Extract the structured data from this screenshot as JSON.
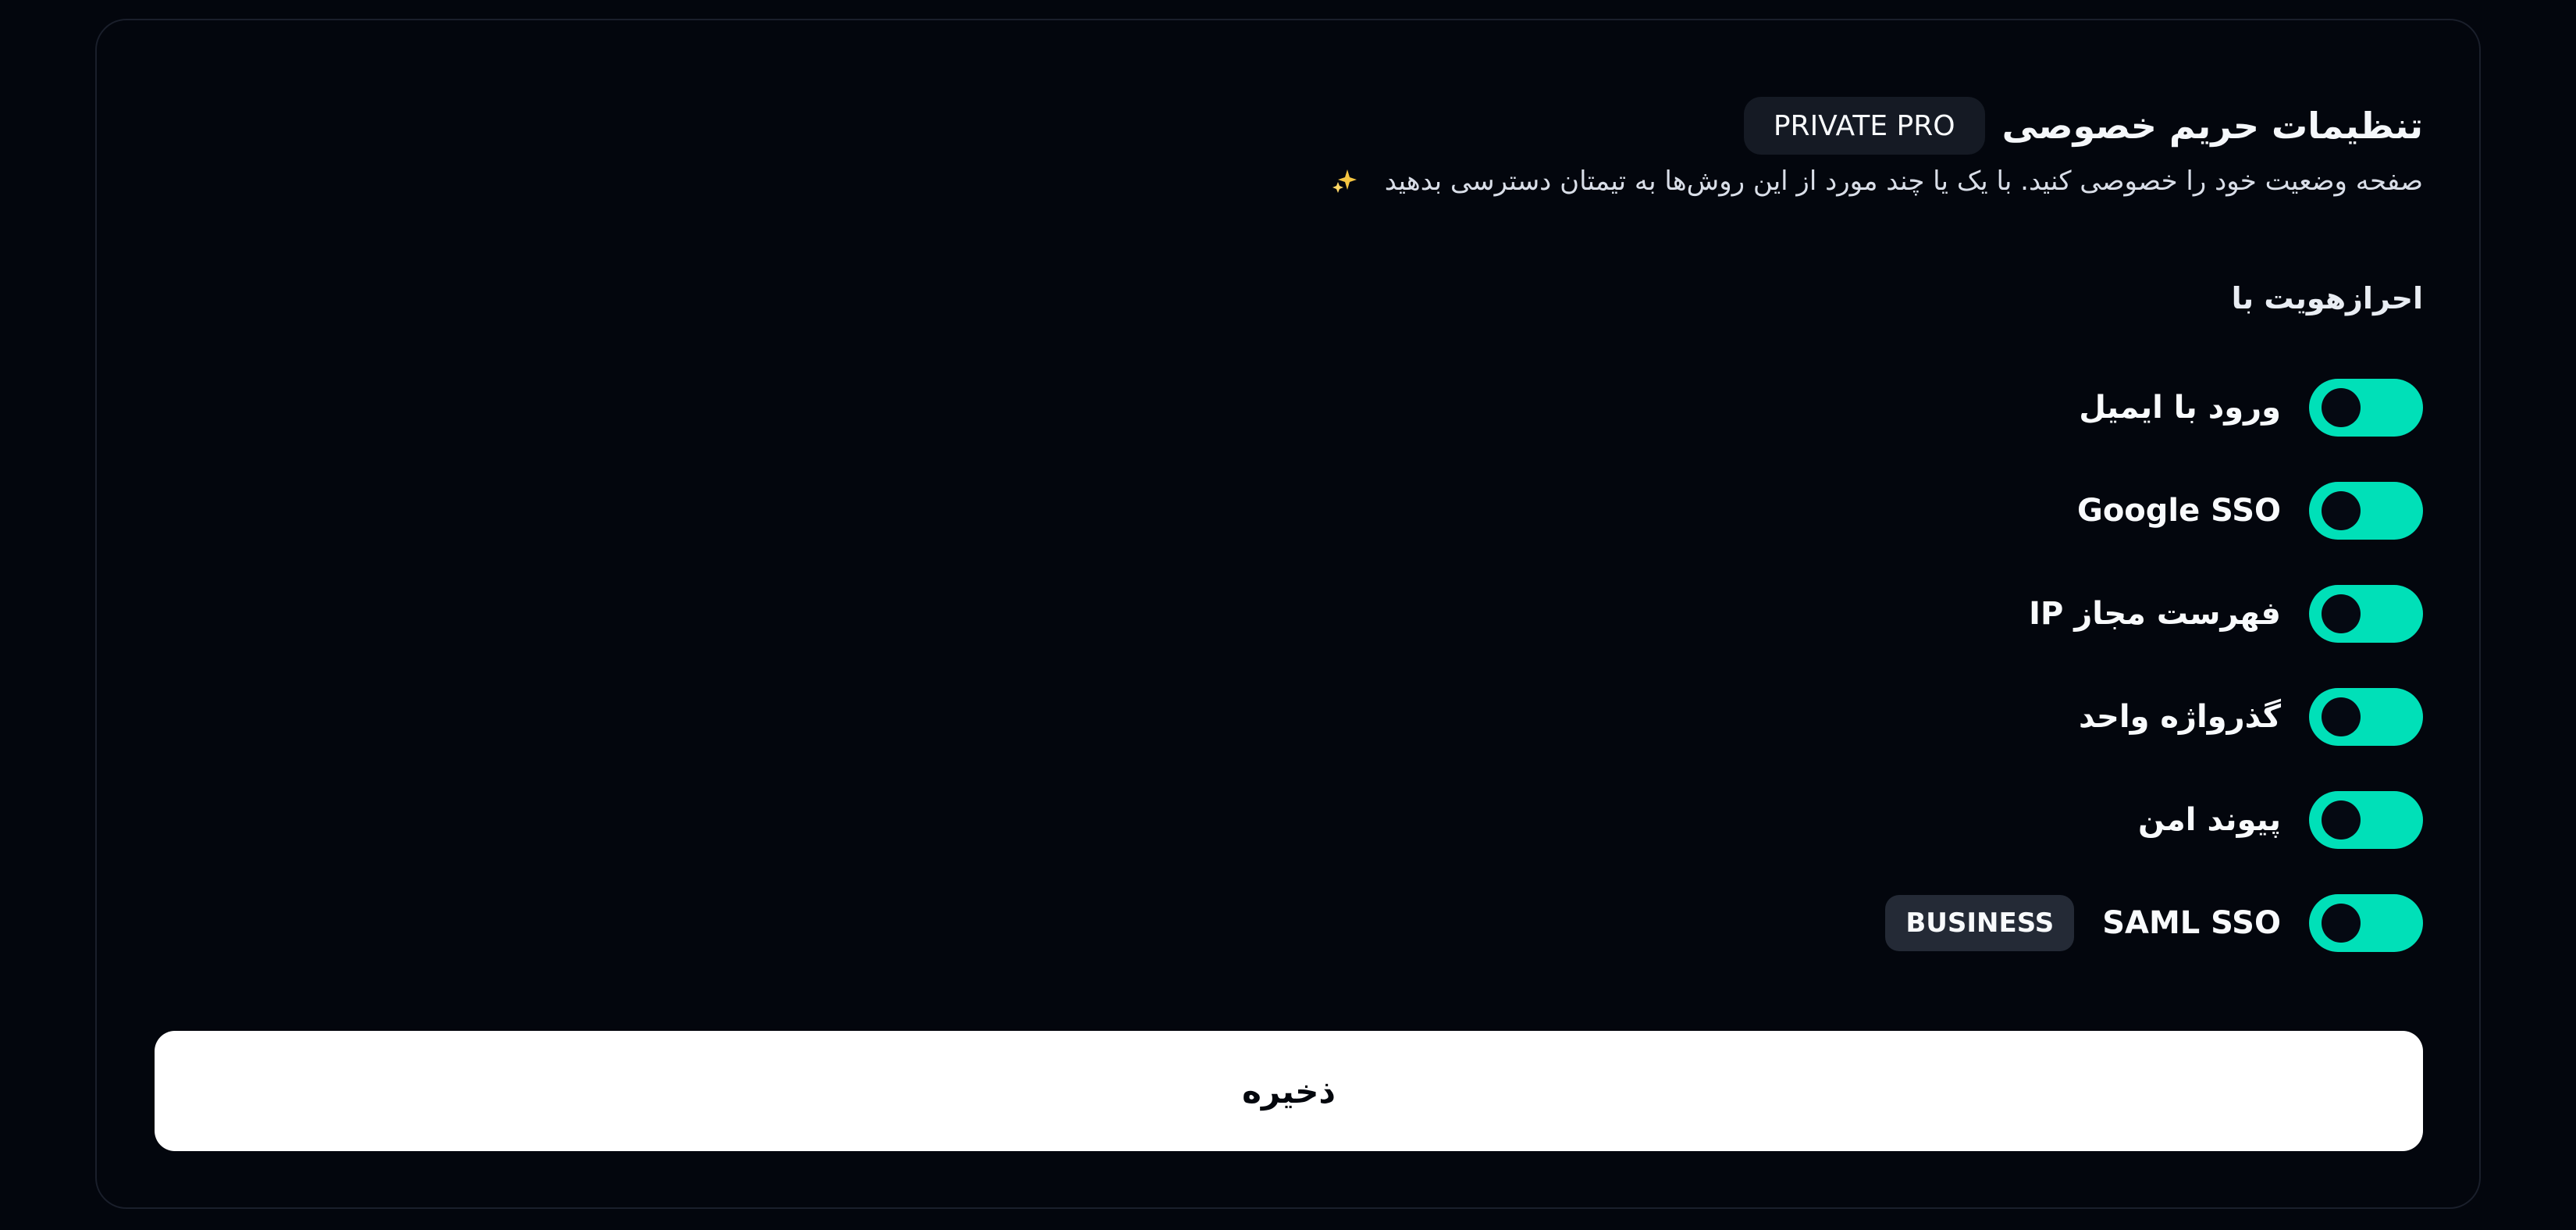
{
  "colors": {
    "background": "#03060d",
    "card_border": "#1a1f2b",
    "toggle_on": "#00e0b8",
    "plan_badge": "#151a24",
    "tier_badge": "#242a36",
    "save_button": "#ffffff"
  },
  "header": {
    "title": "تنظیمات حریم خصوصی",
    "plan_badge": "PRIVATE PRO",
    "subtitle": "صفحه وضعیت خود را خصوصی کنید. با یک یا چند مورد از این روش‌ها به تیمتان دسترسی بدهید",
    "sparkle_icon": "sparkle-icon"
  },
  "section": {
    "label": "احرازهویت با"
  },
  "auth_methods": [
    {
      "label": "ورود با ایمیل",
      "enabled": true
    },
    {
      "label": "Google SSO",
      "enabled": true
    },
    {
      "label": "فهرست مجاز IP",
      "enabled": true
    },
    {
      "label": "گذرواژه واحد",
      "enabled": true
    },
    {
      "label": "پیوند امن",
      "enabled": true
    },
    {
      "label": "SAML SSO",
      "enabled": true,
      "badge": "BUSINESS"
    }
  ],
  "actions": {
    "save_label": "ذخیره"
  }
}
